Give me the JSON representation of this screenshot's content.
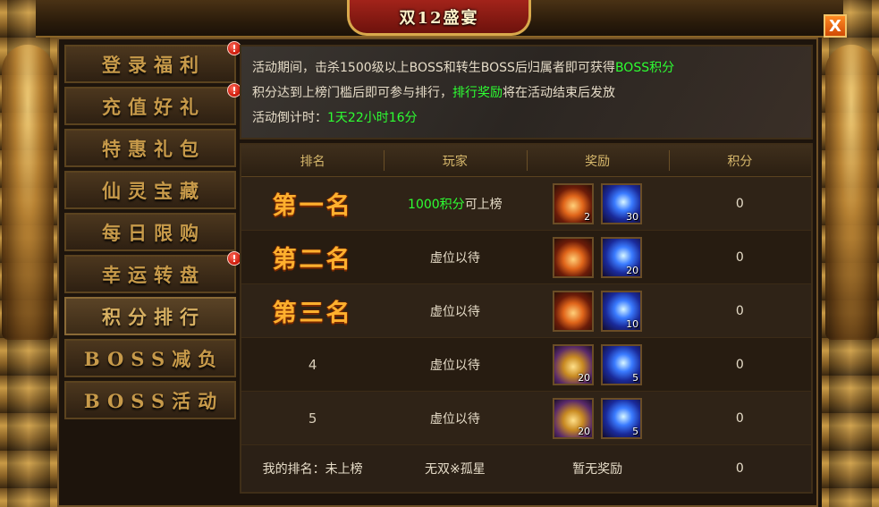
{
  "header": {
    "title": "双12盛宴",
    "close_label": "X"
  },
  "menu": [
    {
      "label": "登录福利",
      "badge": "!"
    },
    {
      "label": "充值好礼",
      "badge": "!"
    },
    {
      "label": "特惠礼包",
      "badge": ""
    },
    {
      "label": "仙灵宝藏",
      "badge": ""
    },
    {
      "label": "每日限购",
      "badge": ""
    },
    {
      "label": "幸运转盘",
      "badge": "!"
    },
    {
      "label": "积分排行",
      "badge": "",
      "active": true
    },
    {
      "label": "BOSS减负",
      "badge": ""
    },
    {
      "label": "BOSS活动",
      "badge": ""
    }
  ],
  "info": {
    "line1_a": "活动期间，击杀1500级以上BOSS和转生BOSS后归属者即可获得",
    "line1_b": "BOSS积分",
    "line2_a": "积分达到上榜门槛后即可参与排行，",
    "line2_b": "排行奖励",
    "line2_c": "将在活动结束后发放",
    "line3_a": "活动倒计时：",
    "line3_b": "1天22小时16分"
  },
  "table": {
    "headers": [
      "排名",
      "玩家",
      "奖励",
      "积分"
    ],
    "rows": [
      {
        "rank": "第一名",
        "player_a": "1000积分",
        "player_b": "可上榜",
        "r1": {
          "icon": "potion-icon",
          "count": "2"
        },
        "r2": {
          "icon": "crystal-icon",
          "count": "30"
        },
        "score": "0"
      },
      {
        "rank": "第二名",
        "player_a": "",
        "player_b": "虚位以待",
        "r1": {
          "icon": "potion-icon",
          "count": ""
        },
        "r2": {
          "icon": "crystal-icon",
          "count": "20"
        },
        "score": "0"
      },
      {
        "rank": "第三名",
        "player_a": "",
        "player_b": "虚位以待",
        "r1": {
          "icon": "potion-icon",
          "count": ""
        },
        "r2": {
          "icon": "crystal-icon",
          "count": "10"
        },
        "score": "0"
      },
      {
        "rank": "4",
        "player_a": "",
        "player_b": "虚位以待",
        "r1": {
          "icon": "treasure-chest-icon",
          "count": "20"
        },
        "r2": {
          "icon": "crystal-icon",
          "count": "5"
        },
        "score": "0"
      },
      {
        "rank": "5",
        "player_a": "",
        "player_b": "虚位以待",
        "r1": {
          "icon": "treasure-chest-icon",
          "count": "20"
        },
        "r2": {
          "icon": "crystal-icon",
          "count": "5"
        },
        "score": "0"
      }
    ],
    "footer": {
      "my_rank": "我的排名：未上榜",
      "player": "无双※孤星",
      "reward": "暂无奖励",
      "score": "0"
    }
  },
  "colors": {
    "highlight": "#2dff32",
    "rank_gold": "#ffb02e",
    "menu_text": "#c79a4a"
  }
}
